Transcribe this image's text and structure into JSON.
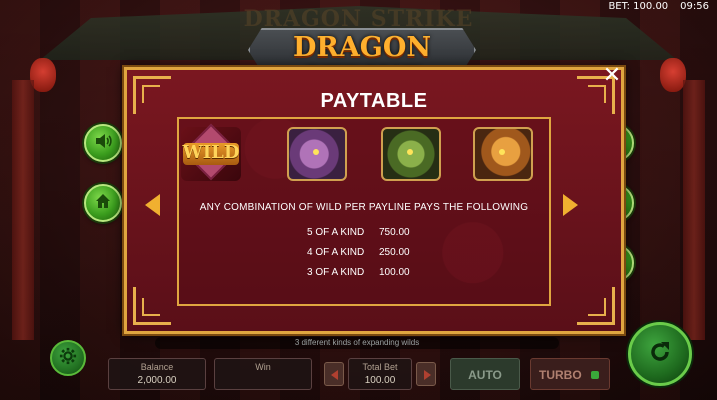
{
  "status": {
    "bet": "BET: 100.00",
    "time": "09:56"
  },
  "background_title": "DRAGON STRIKE",
  "logo": "DRAGON STRIKE",
  "paytable": {
    "title": "PAYTABLE",
    "symbols": [
      "WILD",
      "purple-dragon",
      "green-dragon",
      "gold-dragon"
    ],
    "wild_label": "WILD",
    "description": "ANY COMBINATION OF WILD PER PAYLINE PAYS THE FOLLOWING",
    "payouts": [
      {
        "kind": "5 OF A KIND",
        "amount": "750.00"
      },
      {
        "kind": "4 OF A KIND",
        "amount": "250.00"
      },
      {
        "kind": "3 OF A KIND",
        "amount": "100.00"
      }
    ]
  },
  "icons": {
    "left": [
      "speaker-icon",
      "home-icon"
    ],
    "right": [
      "menu-icon",
      "refresh-icon",
      "coin-icon"
    ]
  },
  "bottom": {
    "message": "3 different kinds of expanding wilds",
    "balance_label": "Balance",
    "balance_value": "2,000.00",
    "win_label": "Win",
    "win_value": "",
    "total_bet_label": "Total Bet",
    "total_bet_value": "100.00",
    "auto_label": "AUTO",
    "turbo_label": "TURBO"
  },
  "colors": {
    "accent_gold": "#e0a640",
    "button_green": "#3b9e1e",
    "panel_red": "#6a1320"
  }
}
